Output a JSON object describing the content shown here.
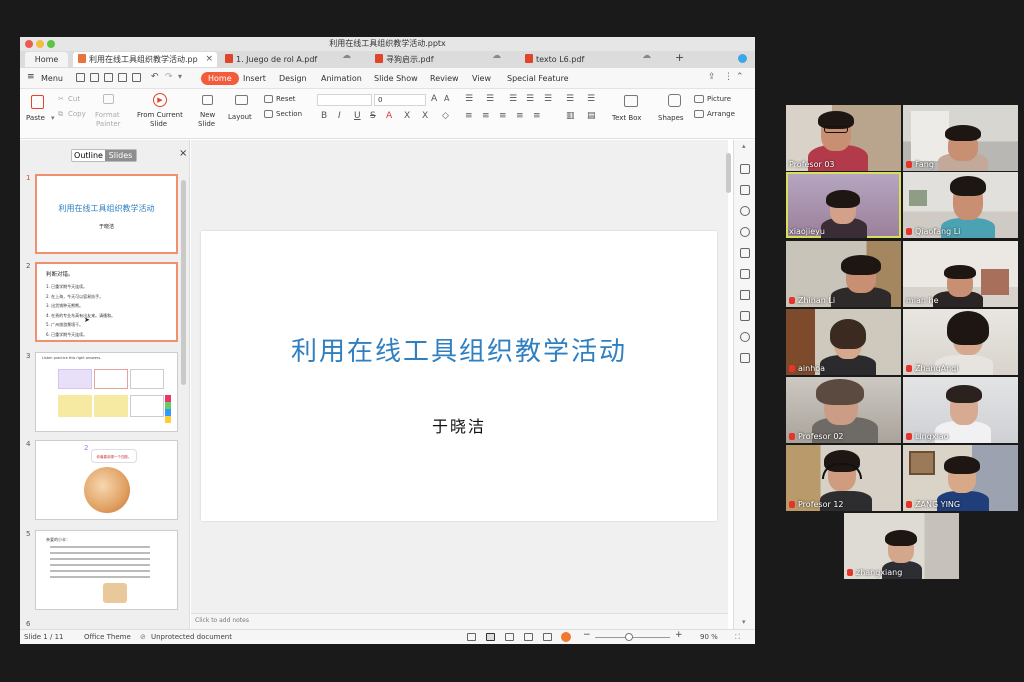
{
  "window": {
    "title": "利用在线工具组织教学活动.pptx"
  },
  "tabs": [
    {
      "label": "Home"
    },
    {
      "label": "利用在线工具组织教学活动.pp"
    },
    {
      "label": "1. Juego de rol A.pdf"
    },
    {
      "label": "寻狗启示.pdf"
    },
    {
      "label": "texto L6.pdf"
    }
  ],
  "menu": {
    "main": "Menu",
    "items": [
      "Home",
      "Insert",
      "Design",
      "Animation",
      "Slide Show",
      "Review",
      "View",
      "Special Feature"
    ]
  },
  "ribbon": {
    "paste": "Paste",
    "cut": "Cut",
    "copy": "Copy",
    "format_painter_1": "Format",
    "format_painter_2": "Painter",
    "from_current_1": "From Current",
    "from_current_2": "Slide",
    "new_slide_1": "New",
    "new_slide_2": "Slide",
    "layout": "Layout",
    "reset": "Reset",
    "section": "Section",
    "font_size": "0",
    "text_box": "Text Box",
    "shapes": "Shapes",
    "picture": "Picture",
    "arrange": "Arrange"
  },
  "panel": {
    "outline": "Outline",
    "slides": "Slides",
    "thumbs": [
      {
        "num": "1",
        "title": "利用在线工具组织教学活动",
        "author": "于晓洁"
      },
      {
        "num": "2",
        "heading": "判断对错。",
        "lines": [
          "1. 已重学期今天连续。",
          "2. 在上海，今天可以容易执手。",
          "3. 出货销种无熊熊。",
          "4. 在贵的专业东高有出友来。请循和。",
          "5. 广州旅游景境干。",
          "6. 已重学期今天连续。"
        ]
      },
      {
        "num": "3",
        "banner": "Listen practice this right answers."
      },
      {
        "num": "4",
        "bubble": "你最喜欢哪一个四肢。"
      },
      {
        "num": "5",
        "greeting": "亲爱的小丰："
      },
      {
        "num": "6"
      }
    ]
  },
  "slide": {
    "title": "利用在线工具组织教学活动",
    "author": "于晓洁"
  },
  "notes_placeholder": "Click to add notes",
  "status": {
    "slide": "Slide 1 / 11",
    "theme": "Office Theme",
    "protection": "Unprotected document",
    "zoom": "90 %"
  },
  "participants": [
    {
      "name": "Profesor 03",
      "muted": false
    },
    {
      "name": "Fang",
      "muted": true
    },
    {
      "name": "xiaojieyu",
      "muted": false
    },
    {
      "name": "Qiaofang Li",
      "muted": true
    },
    {
      "name": "Zhinan Li",
      "muted": true
    },
    {
      "name": "mian he",
      "muted": false
    },
    {
      "name": "ainhoa",
      "muted": true
    },
    {
      "name": "ZhangAnqi",
      "muted": true
    },
    {
      "name": "Profesor 02",
      "muted": true
    },
    {
      "name": "Lingxiao",
      "muted": true
    },
    {
      "name": "Profesor 12",
      "muted": true
    },
    {
      "name": "ZANG YING",
      "muted": true
    },
    {
      "name": "zhangxiang",
      "muted": true
    }
  ],
  "colors": {
    "accent": "#f25c3a",
    "slide_title": "#2f7fc1",
    "active_speaker": "#d6e05a"
  }
}
